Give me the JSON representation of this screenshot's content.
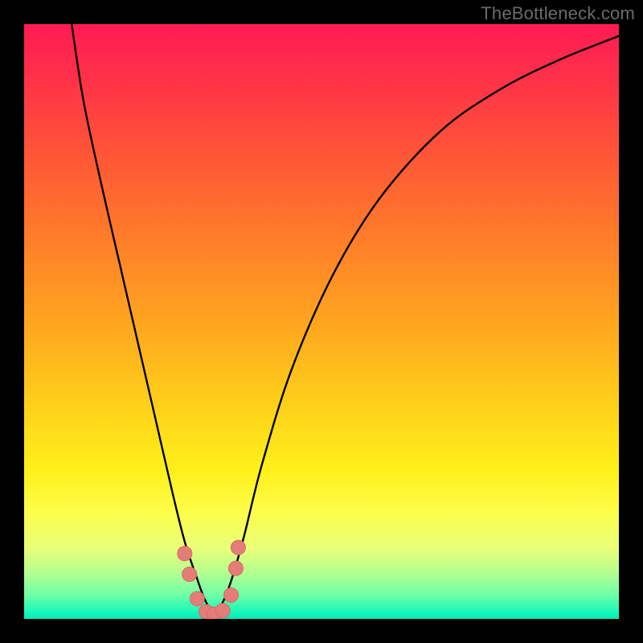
{
  "watermark": {
    "text": "TheBottleneck.com"
  },
  "chart_data": {
    "type": "line",
    "title": "",
    "xlabel": "",
    "ylabel": "",
    "xlim": [
      0,
      100
    ],
    "ylim": [
      0,
      100
    ],
    "series": [
      {
        "name": "curve",
        "x": [
          8,
          10,
          13,
          16,
          19,
          22,
          25,
          27,
          29,
          30.5,
          32,
          33.5,
          35,
          37,
          40,
          45,
          52,
          60,
          70,
          80,
          90,
          100
        ],
        "y": [
          100,
          87,
          73,
          60,
          47,
          34,
          21,
          13,
          7,
          3,
          1,
          3,
          7,
          14,
          26,
          42,
          58,
          71,
          82,
          89,
          94,
          98
        ]
      }
    ],
    "markers": [
      {
        "x": 27.0,
        "y": 11.0
      },
      {
        "x": 27.8,
        "y": 7.5
      },
      {
        "x": 29.1,
        "y": 3.4
      },
      {
        "x": 30.6,
        "y": 1.2
      },
      {
        "x": 32.0,
        "y": 0.8
      },
      {
        "x": 33.4,
        "y": 1.4
      },
      {
        "x": 34.8,
        "y": 4.0
      },
      {
        "x": 35.6,
        "y": 8.5
      },
      {
        "x": 36.0,
        "y": 12.0
      }
    ],
    "colors": {
      "curve": "#000000",
      "marker_fill": "#e47c78",
      "marker_stroke": "#d66a66"
    }
  }
}
